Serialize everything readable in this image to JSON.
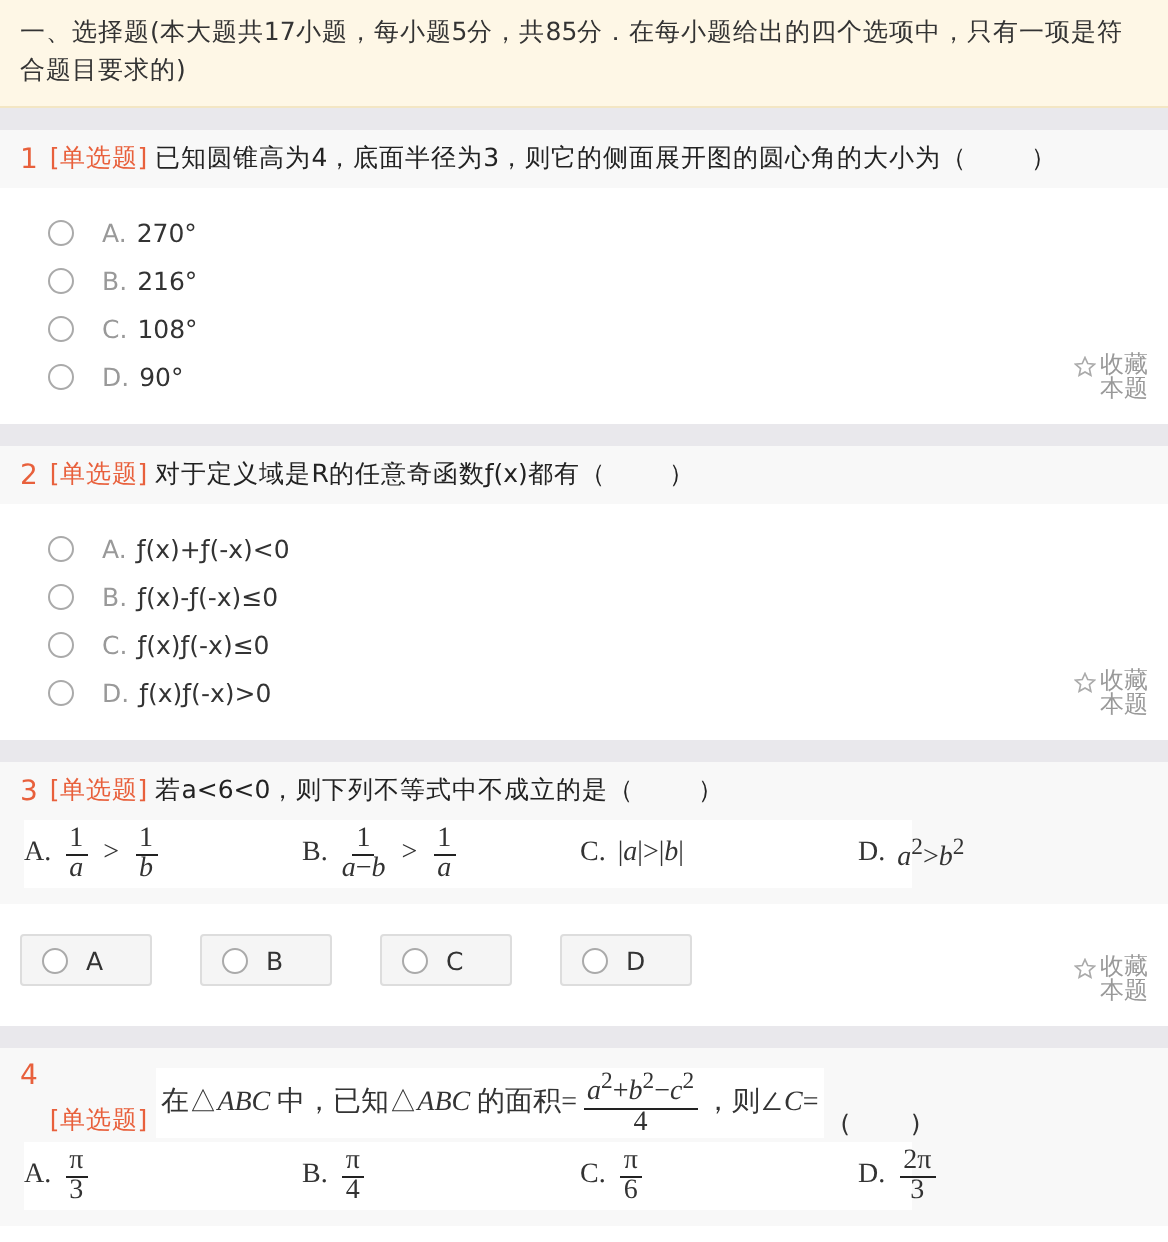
{
  "section_heading": "一、选择题(本大题共17小题，每小题5分，共85分．在每小题给出的四个选项中，只有一项是符合题目要求的)",
  "questions": [
    {
      "number": "1",
      "type_tag": "[单选题]",
      "kind": "list",
      "stem": "已知圆锥高为4，底面半径为3，则它的侧面展开图的圆心角的大小为（        ）",
      "options": [
        {
          "letter": "A.",
          "text": "270°",
          "selected": false
        },
        {
          "letter": "B.",
          "text": "216°",
          "selected": false
        },
        {
          "letter": "C.",
          "text": "108°",
          "selected": false
        },
        {
          "letter": "D.",
          "text": "90°",
          "selected": false
        }
      ],
      "favorite": "收藏本题"
    },
    {
      "number": "2",
      "type_tag": "[单选题]",
      "kind": "list",
      "stem": "对于定义域是R的任意奇函数ƒ(x)都有（        ）",
      "options": [
        {
          "letter": "A.",
          "text": "ƒ(x)+ƒ(-x)<0",
          "selected": false
        },
        {
          "letter": "B.",
          "text": "ƒ(x)-ƒ(-x)≤0",
          "selected": false
        },
        {
          "letter": "C.",
          "text": "ƒ(x)ƒ(-x)≤0",
          "selected": false
        },
        {
          "letter": "D.",
          "text": "ƒ(x)ƒ(-x)>0",
          "selected": false
        }
      ],
      "favorite": "收藏本题"
    },
    {
      "number": "3",
      "type_tag": "[单选题]",
      "kind": "buttons",
      "stem": "若a<6<0，则下列不等式中不成立的是（        ）",
      "math_options": [
        {
          "letter": "A.",
          "parts": [
            {
              "kind": "frac",
              "num": "1",
              "den": "*a*"
            },
            {
              "kind": "text",
              "text": ">"
            },
            {
              "kind": "frac",
              "num": "1",
              "den": "*b*"
            }
          ]
        },
        {
          "letter": "B.",
          "parts": [
            {
              "kind": "frac",
              "num": "1",
              "den": "*a*−*b*"
            },
            {
              "kind": "text",
              "text": ">"
            },
            {
              "kind": "frac",
              "num": "1",
              "den": "*a*"
            }
          ]
        },
        {
          "letter": "C.",
          "parts": [
            {
              "kind": "text",
              "text": "|*a*|>|*b*|"
            }
          ]
        },
        {
          "letter": "D.",
          "parts": [
            {
              "kind": "text",
              "text": "*a*$^{2}$>*b*$^{2}$"
            }
          ]
        }
      ],
      "options": [
        {
          "letter": "A",
          "selected": false
        },
        {
          "letter": "B",
          "selected": false
        },
        {
          "letter": "C",
          "selected": false
        },
        {
          "letter": "D",
          "selected": false
        }
      ],
      "favorite": "收藏本题"
    },
    {
      "number": "4",
      "type_tag": "[单选题]",
      "kind": "math",
      "stem_parts": [
        {
          "kind": "text",
          "text": "在△*ABC* 中，已知△*ABC* 的面积="
        },
        {
          "kind": "frac",
          "num": "*a*$^{2}$+*b*$^{2}$−*c*$^{2}$",
          "den": "4"
        },
        {
          "kind": "text",
          "text": "，则∠*C*="
        }
      ],
      "paren": "(        )",
      "math_options": [
        {
          "letter": "A.",
          "parts": [
            {
              "kind": "frac",
              "num": "π",
              "den": "3"
            }
          ]
        },
        {
          "letter": "B.",
          "parts": [
            {
              "kind": "frac",
              "num": "π",
              "den": "4"
            }
          ]
        },
        {
          "letter": "C.",
          "parts": [
            {
              "kind": "frac",
              "num": "π",
              "den": "6"
            }
          ]
        },
        {
          "letter": "D.",
          "parts": [
            {
              "kind": "frac",
              "num": "2π",
              "den": "3"
            }
          ]
        }
      ]
    }
  ]
}
